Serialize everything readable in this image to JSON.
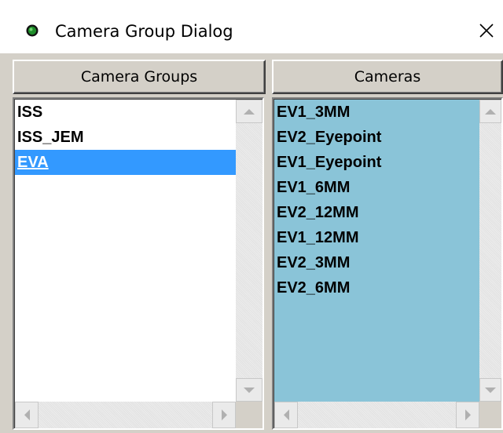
{
  "window": {
    "title": "Camera Group Dialog",
    "close_glyph": "✕"
  },
  "groups": {
    "header": "Camera Groups",
    "items": [
      {
        "label": "ISS",
        "selected": false
      },
      {
        "label": "ISS_JEM",
        "selected": false
      },
      {
        "label": "EVA",
        "selected": true
      }
    ]
  },
  "cameras": {
    "header": "Cameras",
    "items": [
      {
        "label": "EV1_3MM"
      },
      {
        "label": "EV2_Eyepoint"
      },
      {
        "label": "EV1_Eyepoint"
      },
      {
        "label": "EV1_6MM"
      },
      {
        "label": "EV2_12MM"
      },
      {
        "label": "EV1_12MM"
      },
      {
        "label": "EV2_3MM"
      },
      {
        "label": "EV2_6MM"
      }
    ]
  },
  "colors": {
    "selection": "#3399ff",
    "cameras_background": "#8ac4d8",
    "dialog_face": "#d4d0c8"
  }
}
